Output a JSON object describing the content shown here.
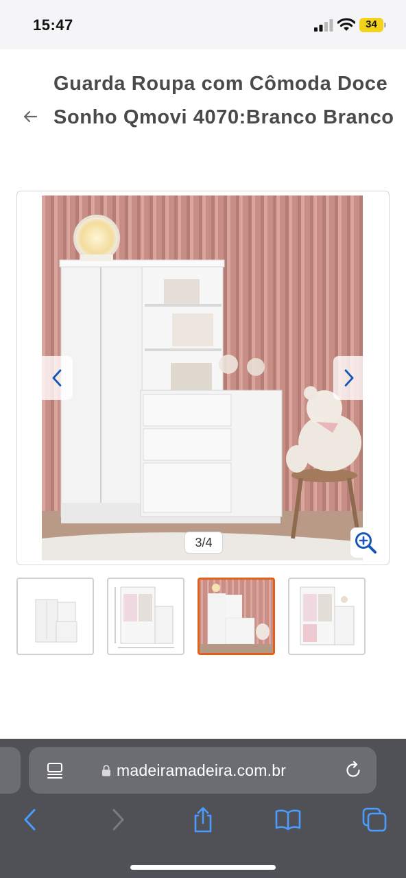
{
  "status_bar": {
    "time": "15:47",
    "battery_level": "34"
  },
  "product": {
    "title": "Guarda Roupa com Cômoda Doce Sonho Qmovi 4070:Branco Branco"
  },
  "gallery": {
    "counter": "3/4",
    "current_index": 3,
    "total_images": 4,
    "accent_color": "#e2611a"
  },
  "browser": {
    "url": "madeiramadeira.com.br",
    "toolbar_icons": [
      "back-icon",
      "forward-icon",
      "share-icon",
      "bookmarks-icon",
      "tabs-icon"
    ],
    "icon_color": "#4a9dff"
  }
}
